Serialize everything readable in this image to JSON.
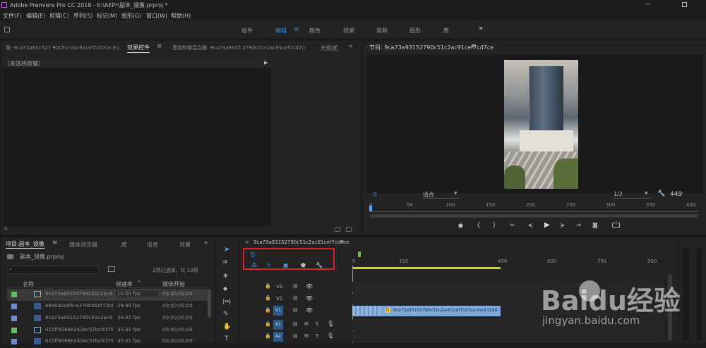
{
  "window": {
    "title": "Adobe Premiere Pro CC 2018 - E:\\AEPr\\副本_镜像.prproj *"
  },
  "menus": [
    "文件(F)",
    "编辑(E)",
    "剪辑(C)",
    "序列(S)",
    "标记(M)",
    "图形(G)",
    "窗口(W)",
    "帮助(H)"
  ],
  "workspaces": [
    "组件",
    "编辑",
    "颜色",
    "效果",
    "音频",
    "图形",
    "库"
  ],
  "active_workspace": "编辑",
  "more": "»",
  "source_panel": {
    "source_tab": "源: 9ca73a931527 90c51c2ac91cef7cd7ce.mp4",
    "effect_controls_tab": "效果控件",
    "audio_mixer_tab": "音频剪辑混合器: 9ca73a9315 2790c51c2ac91cef7cd7ce",
    "metadata_tab": "元数据",
    "no_clip": "（未选择剪辑）",
    "timecode": "0"
  },
  "program_panel": {
    "title": "节目: 9ca73a93152790c51c2ac91cef7cd7ce",
    "timecode": "0",
    "fit": "适合",
    "resolution": "1/2",
    "duration": "449",
    "ruler": [
      "0",
      "50",
      "100",
      "150",
      "200",
      "250",
      "300",
      "350",
      "400"
    ]
  },
  "project_panel": {
    "tabs": [
      "项目:副本_镜像",
      "媒体浏览器",
      "库",
      "信息",
      "效果"
    ],
    "project_file": "副本_镜像.prproj",
    "selection": "1项已选择，共 10项",
    "columns": [
      "名称",
      "帧速率",
      "媒体开始"
    ],
    "rows": [
      {
        "name": "9ca73a93152790c51c2ac91cef",
        "fps": "10.00 fps",
        "start": "00;00;00;00",
        "color": "#5cc05c",
        "selected": true
      },
      {
        "name": "e8ababa85ca378bb5df73b8c",
        "fps": "29.99 fps",
        "start": "00;00;00;00",
        "color": "#6a8fd0"
      },
      {
        "name": "9ca73a93152790c51c2ac91cef",
        "fps": "30.01 fps",
        "start": "00;00;00;00",
        "color": "#6a8fd0"
      },
      {
        "name": "015ff4068e242ec57bcfcf75215",
        "fps": "30.01 fps",
        "start": "00;00;00;00",
        "color": "#5cc05c"
      },
      {
        "name": "015ff4068e242ec57bcfcf75215",
        "fps": "30.01 fps",
        "start": "00;00;00;00",
        "color": "#6a8fd0"
      }
    ]
  },
  "timeline": {
    "sequence": "9ca73a93152790c51c2ac91cef7cd7ce",
    "timecode": "0",
    "ruler": [
      "0",
      "150",
      "450",
      "600",
      "750",
      "900"
    ],
    "video_tracks": [
      "V3",
      "V2",
      "V1"
    ],
    "audio_tracks": [
      "A1",
      "A2"
    ],
    "clip_label": "9ca73a93152790c51c2ac91cef7cd7ce.mp4 [109.59%]",
    "mute": "M",
    "solo": "S"
  },
  "watermark": {
    "brand": "Baidu经验",
    "url": "jingyan.baidu.com"
  },
  "colors": {
    "accent": "#2d8ceb",
    "highlight_box": "#e02020",
    "clip": "#7fa7d8",
    "playhead": "#4ea2ff"
  }
}
